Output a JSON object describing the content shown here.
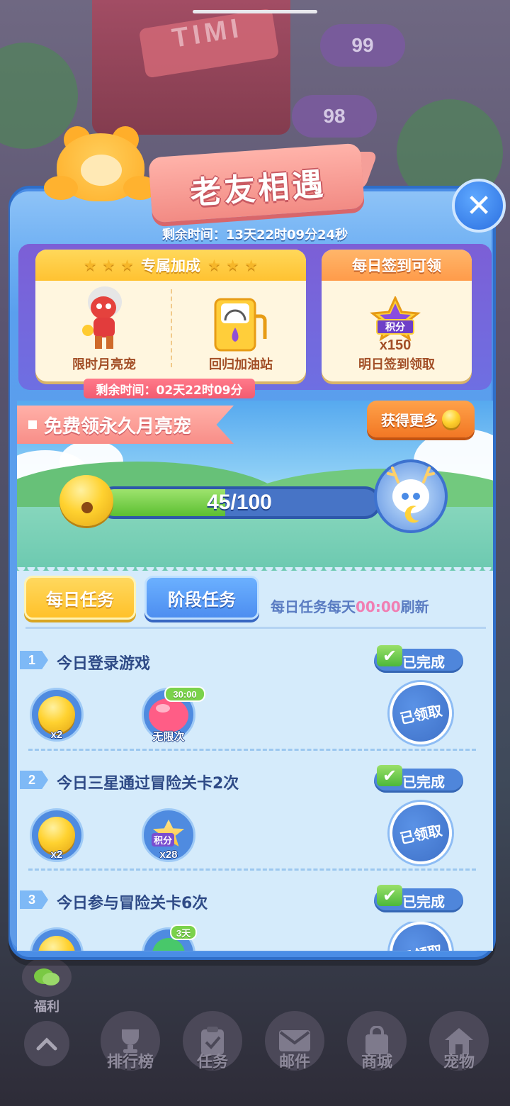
{
  "background": {
    "levels": [
      "99",
      "98"
    ],
    "sign_text": "TIMI"
  },
  "header": {
    "title": "老友相遇",
    "remaining_time": "剩余时间：13天22时09分24秒",
    "close_icon": "close-icon"
  },
  "bonus_card": {
    "header": "专属加成",
    "items": [
      {
        "label": "限时月亮宠",
        "icon": "red-pet-icon"
      },
      {
        "label": "回归加油站",
        "icon": "fuel-pump-icon"
      }
    ],
    "timer": "剩余时间：02天22时09分"
  },
  "signin_card": {
    "header": "每日签到可领",
    "badge_text": "积分",
    "count": "x150",
    "label": "明日签到领取"
  },
  "moon_pet": {
    "banner": "免费领永久月亮宠",
    "more_button": "获得更多",
    "progress_text": "45/100",
    "progress_value": 45,
    "progress_max": 100
  },
  "tabs": {
    "daily": "每日任务",
    "stage": "阶段任务",
    "refresh_prefix": "每日任务每天",
    "refresh_time": "00:00",
    "refresh_suffix": "刷新"
  },
  "tasks": [
    {
      "num": "1",
      "title": "今日登录游戏",
      "status": "已完成",
      "claim": "已领取",
      "rewards": [
        {
          "icon": "bell-icon",
          "count": "x2"
        },
        {
          "icon": "heart-icon",
          "count": "无限次",
          "tag": "30:00"
        }
      ]
    },
    {
      "num": "2",
      "title": "今日三星通过冒险关卡2次",
      "status": "已完成",
      "claim": "已领取",
      "rewards": [
        {
          "icon": "bell-icon",
          "count": "x2"
        },
        {
          "icon": "points-star-icon",
          "count": "x28",
          "badge": "积分"
        }
      ]
    },
    {
      "num": "3",
      "title": "今日参与冒险关卡6次",
      "status": "已完成",
      "claim": "已领取",
      "rewards": [
        {
          "icon": "bell-icon"
        },
        {
          "icon": "candy-icon",
          "tag": "3天"
        }
      ]
    }
  ],
  "side": {
    "fuli": "福利"
  },
  "nav": {
    "items": [
      {
        "label": "",
        "icon": "chevron-up-icon"
      },
      {
        "label": "排行榜",
        "icon": "trophy-icon"
      },
      {
        "label": "任务",
        "icon": "clipboard-icon"
      },
      {
        "label": "邮件",
        "icon": "mail-icon"
      },
      {
        "label": "商城",
        "icon": "shopping-bag-icon"
      },
      {
        "label": "宠物",
        "icon": "home-icon"
      }
    ]
  }
}
